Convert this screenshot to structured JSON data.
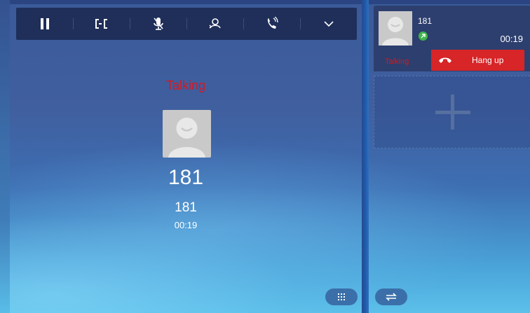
{
  "toolbar": {
    "buttons": [
      {
        "name": "hold",
        "icon": "pause-icon"
      },
      {
        "name": "transfer",
        "icon": "transfer-icon"
      },
      {
        "name": "mute",
        "icon": "mic-mute-icon"
      },
      {
        "name": "conference",
        "icon": "conference-icon"
      },
      {
        "name": "speaker",
        "icon": "handset-volume-icon"
      },
      {
        "name": "more",
        "icon": "chevron-down-icon"
      }
    ]
  },
  "main": {
    "status": "Talking",
    "caller_number": "181",
    "caller_name": "181",
    "duration": "00:19",
    "avatar_icon": "person-avatar-icon"
  },
  "footer": {
    "dialpad_icon": "dialpad-icon",
    "switch_icon": "swap-arrows-icon"
  },
  "call_list": {
    "active_call": {
      "number": "181",
      "duration": "00:19",
      "status": "Talking",
      "direction_icon": "outgoing-call-icon",
      "hangup_label": "Hang up"
    },
    "add_slot_icon": "plus-icon"
  },
  "colors": {
    "status_red": "#e0141a",
    "hangup_red": "#d72528",
    "toolbar_bg": "#1f2f5a",
    "badge_green": "#3fb64a"
  }
}
